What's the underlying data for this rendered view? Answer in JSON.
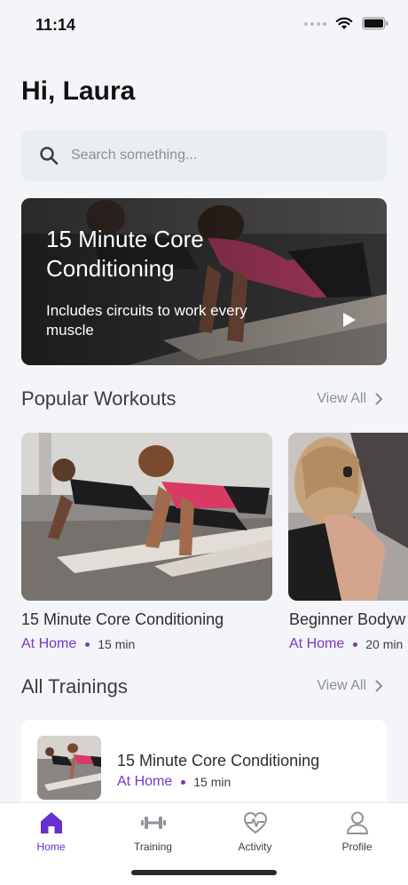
{
  "status_bar": {
    "time": "11:14"
  },
  "greeting": "Hi, Laura",
  "search": {
    "placeholder": "Search something..."
  },
  "hero": {
    "title": "15 Minute Core Conditioning",
    "subtitle": "Includes circuits to work every muscle"
  },
  "popular": {
    "title": "Popular Workouts",
    "view_all": "View All",
    "cards": [
      {
        "title": "15 Minute Core Conditioning",
        "location": "At Home",
        "duration": "15 min"
      },
      {
        "title": "Beginner Bodyw",
        "location": "At Home",
        "duration": "20 min"
      }
    ]
  },
  "trainings": {
    "title": "All Trainings",
    "view_all": "View All",
    "items": [
      {
        "title": "15 Minute Core Conditioning",
        "location": "At Home",
        "duration": "15 min"
      }
    ]
  },
  "tabs": [
    {
      "label": "Home",
      "icon": "home-icon",
      "active": true
    },
    {
      "label": "Training",
      "icon": "dumbbell-icon",
      "active": false
    },
    {
      "label": "Activity",
      "icon": "heart-pulse-icon",
      "active": false
    },
    {
      "label": "Profile",
      "icon": "user-icon",
      "active": false
    }
  ],
  "colors": {
    "accent": "#7b35c8",
    "tab_active": "#6a2fd1",
    "background": "#f3f5f8"
  }
}
